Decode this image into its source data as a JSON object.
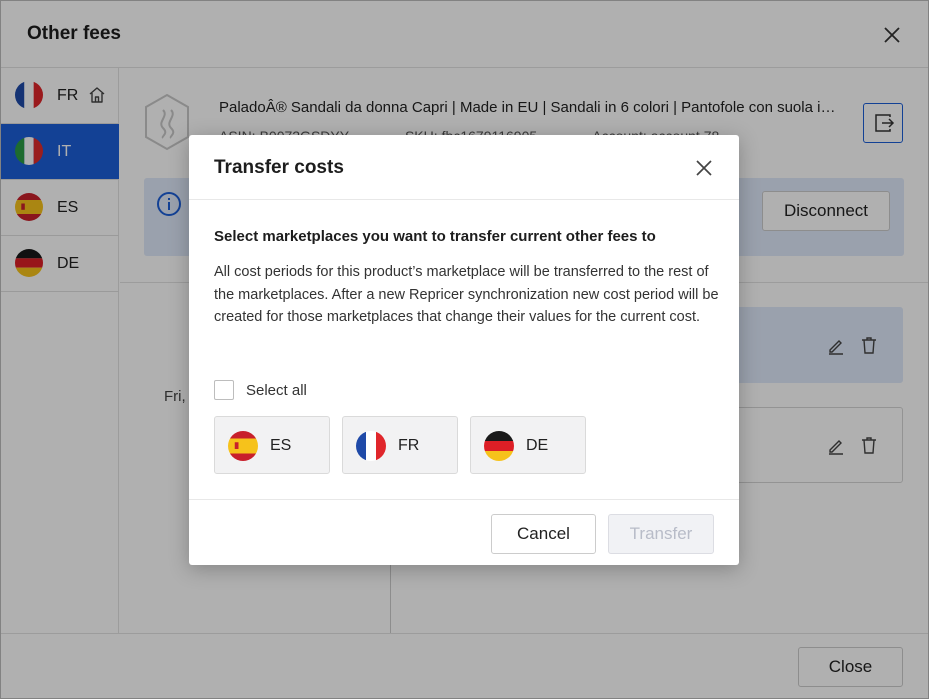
{
  "window": {
    "title": "Other fees",
    "close_label": "Close"
  },
  "sidebar": {
    "items": [
      {
        "code": "FR",
        "flag": "france",
        "home": true,
        "active": false
      },
      {
        "code": "IT",
        "flag": "italy",
        "home": false,
        "active": true
      },
      {
        "code": "ES",
        "flag": "spain",
        "home": false,
        "active": false
      },
      {
        "code": "DE",
        "flag": "germany",
        "home": false,
        "active": false
      }
    ]
  },
  "product": {
    "title": "PaladoÂ® Sandali da donna Capri | Made in EU | Sandali in 6 colori | Pantofole con suola in...",
    "asin_label": "ASIN:",
    "asin": "B0072GSDYY",
    "sku_label": "SKU:",
    "sku": "fbc1679116905",
    "account_label": "Account:",
    "account": "account 78"
  },
  "info": {
    "disconnect_label": "Disconnect"
  },
  "periods": {
    "date_text": "Fri,"
  },
  "modal": {
    "title": "Transfer costs",
    "heading": "Select marketplaces you want to transfer current other fees to",
    "description": "All cost periods for this product’s marketplace will be transferred to the rest of the marketplaces. After a new Repricer synchronization new cost period will be created for those marketplaces that change their values for the current cost.",
    "select_all_label": "Select all",
    "marketplaces": [
      {
        "code": "ES",
        "flag": "spain"
      },
      {
        "code": "FR",
        "flag": "france"
      },
      {
        "code": "DE",
        "flag": "germany"
      }
    ],
    "cancel_label": "Cancel",
    "transfer_label": "Transfer"
  },
  "colors": {
    "accent": "#1c5fd8",
    "info_bg": "#dfe9fb",
    "disabled_text": "#b8bcc8"
  }
}
